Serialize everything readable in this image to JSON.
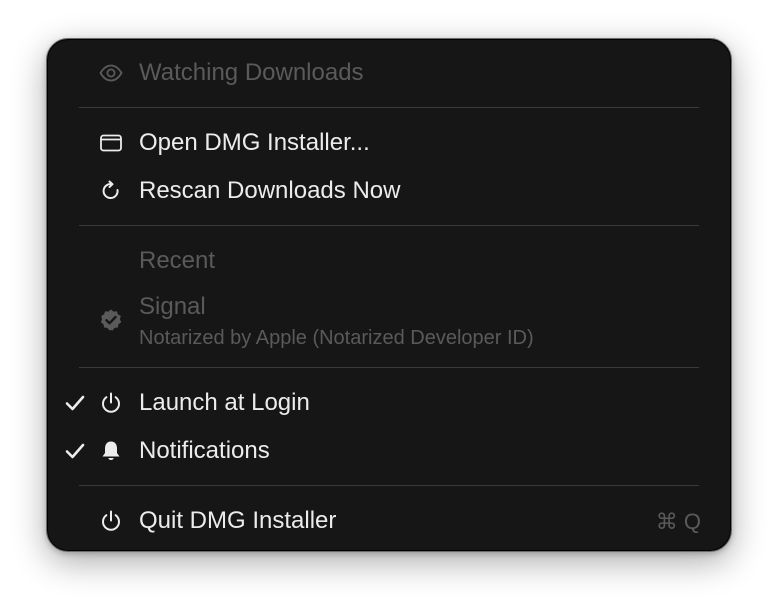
{
  "menu": {
    "status": {
      "label": "Watching Downloads",
      "icon": "eye-icon"
    },
    "open_installer": {
      "label": "Open DMG Installer...",
      "icon": "window-icon"
    },
    "rescan": {
      "label": "Rescan Downloads Now",
      "icon": "refresh-icon"
    },
    "recent": {
      "header": "Recent",
      "items": [
        {
          "title": "Signal",
          "subtitle": "Notarized by Apple (Notarized Developer ID)",
          "icon": "verified-badge-icon"
        }
      ]
    },
    "launch_at_login": {
      "label": "Launch at Login",
      "checked": true,
      "icon": "power-icon"
    },
    "notifications": {
      "label": "Notifications",
      "checked": true,
      "icon": "bell-icon"
    },
    "quit": {
      "label": "Quit DMG Installer",
      "shortcut": "⌘ Q",
      "icon": "power-icon"
    }
  },
  "colors": {
    "menu_background": "#161616",
    "text_primary": "#ececec",
    "text_disabled": "#5a5a5a",
    "separator": "#3a3a3a"
  }
}
